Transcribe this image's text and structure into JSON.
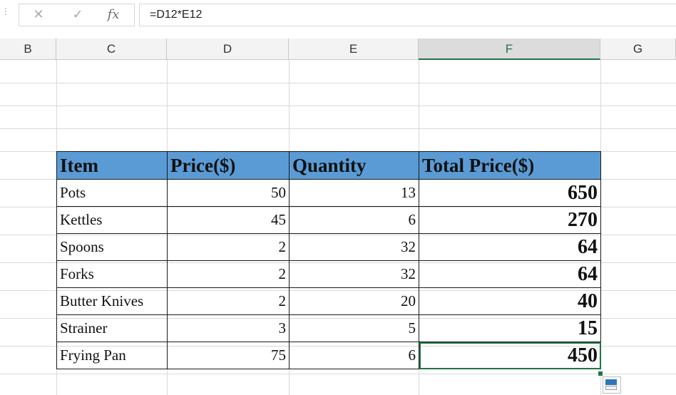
{
  "formula_bar": {
    "grip": "⋮",
    "cancel_icon": "✕",
    "enter_icon": "✓",
    "fx_label": "fx",
    "formula": "=D12*E12"
  },
  "columns": [
    "B",
    "C",
    "D",
    "E",
    "F",
    "G"
  ],
  "selected_column": "F",
  "selection_color": "#217346",
  "header_fill": "#5b9bd5",
  "table": {
    "headers": [
      "Item",
      "Price($)",
      "Quantity",
      "Total Price($)"
    ],
    "rows": [
      {
        "item": "Pots",
        "price": "50",
        "qty": "13",
        "total": "650"
      },
      {
        "item": "Kettles",
        "price": "45",
        "qty": "6",
        "total": "270"
      },
      {
        "item": "Spoons",
        "price": "2",
        "qty": "32",
        "total": "64"
      },
      {
        "item": "Forks",
        "price": "2",
        "qty": "32",
        "total": "64"
      },
      {
        "item": "Butter Knives",
        "price": "2",
        "qty": "20",
        "total": "40"
      },
      {
        "item": "Strainer",
        "price": "3",
        "qty": "5",
        "total": "15"
      },
      {
        "item": "Frying Pan",
        "price": "75",
        "qty": "6",
        "total": "450"
      }
    ]
  }
}
